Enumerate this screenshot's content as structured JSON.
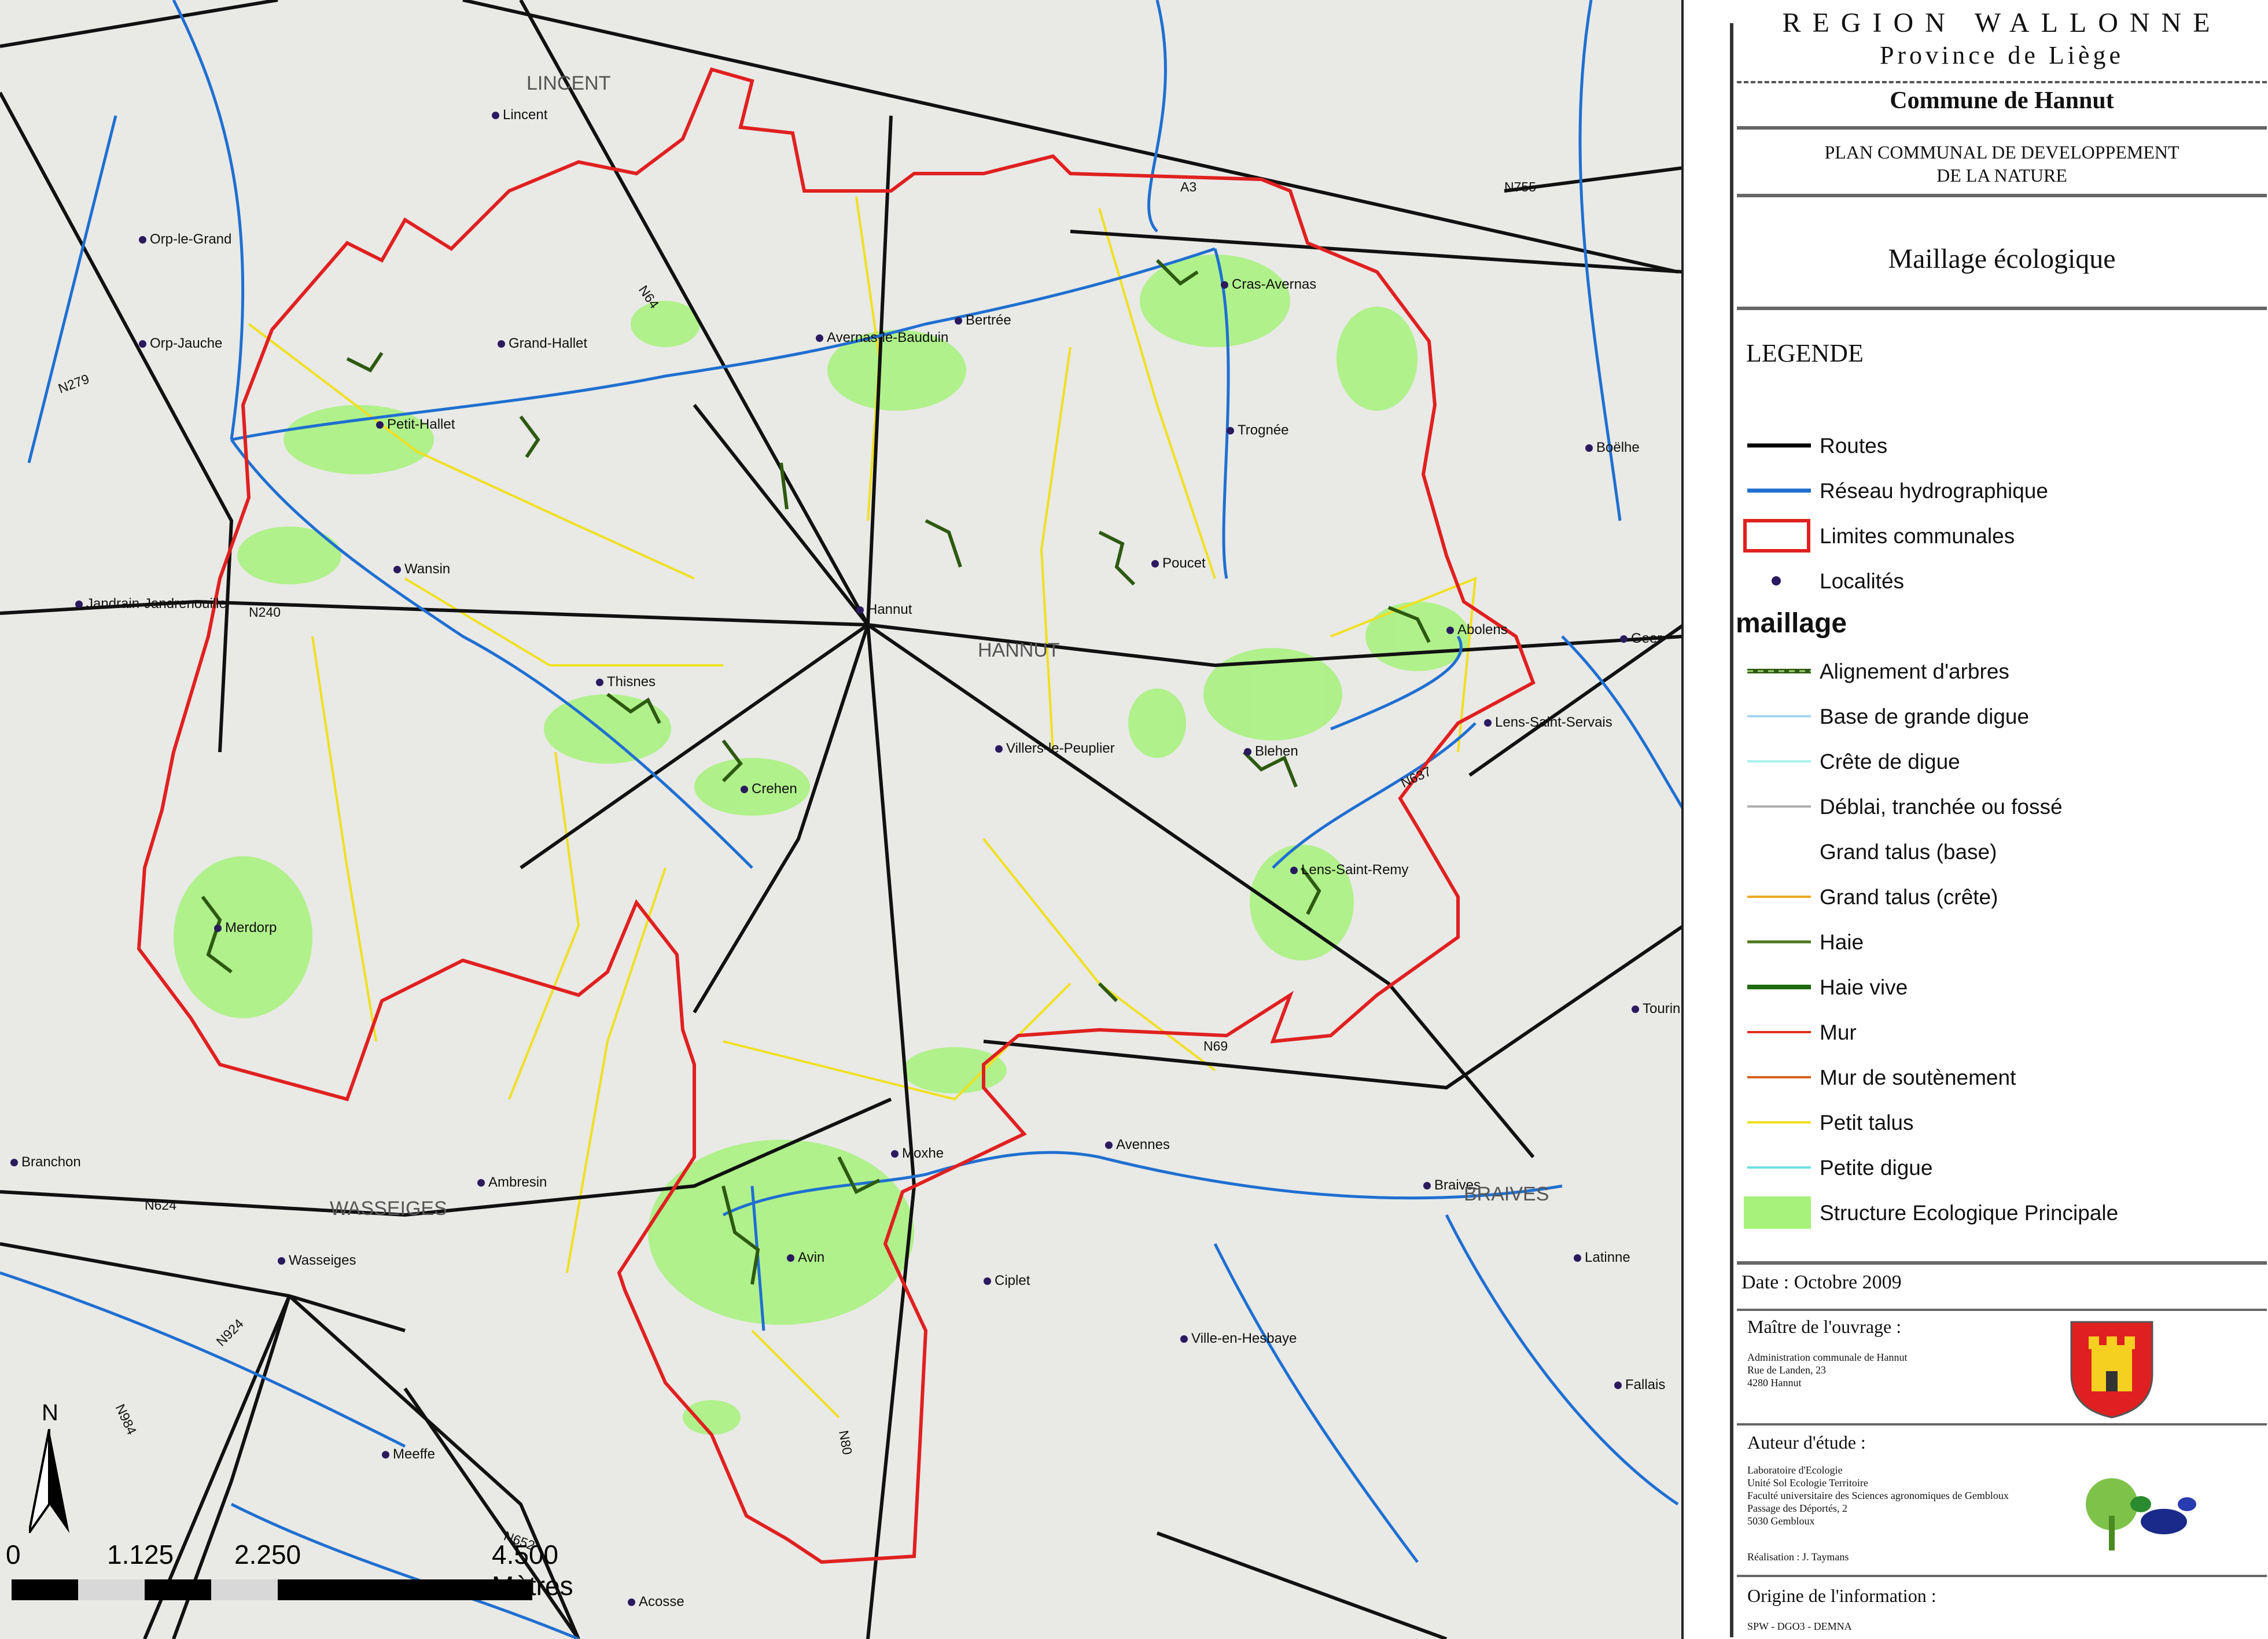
{
  "header": {
    "region": "REGION WALLONNE",
    "province": "Province de Liège",
    "commune": "Commune de Hannut",
    "plan_line1": "PLAN COMMUNAL DE DEVELOPPEMENT",
    "plan_line2": "DE LA NATURE",
    "map_title": "Maillage écologique"
  },
  "legend": {
    "title": "LEGENDE",
    "group_title": "maillage",
    "items_top": [
      {
        "label": "Routes",
        "color": "#000000",
        "kind": "line"
      },
      {
        "label": "Réseau hydrographique",
        "color": "#1f6fd1",
        "kind": "line"
      },
      {
        "label": "Limites communales",
        "color": "#e02020",
        "kind": "box"
      },
      {
        "label": "Localités",
        "color": "#2a1a5e",
        "kind": "dot"
      }
    ],
    "items_maillage": [
      {
        "label": "Alignement d'arbres",
        "color": "#2d5a10",
        "kind": "dashline"
      },
      {
        "label": "Base de grande digue",
        "color": "#a8d4f0",
        "kind": "line"
      },
      {
        "label": "Crête de digue",
        "color": "#a8f0ec",
        "kind": "line"
      },
      {
        "label": "Déblai, tranchée ou fossé",
        "color": "#b0b0b0",
        "kind": "line"
      },
      {
        "label": "Grand talus (base)",
        "color": "#ffffff",
        "kind": "line"
      },
      {
        "label": "Grand talus (crête)",
        "color": "#f0a820",
        "kind": "line"
      },
      {
        "label": "Haie",
        "color": "#4f7a1c",
        "kind": "line"
      },
      {
        "label": "Haie vive",
        "color": "#1e6a10",
        "kind": "line"
      },
      {
        "label": "Mur",
        "color": "#e03020",
        "kind": "line"
      },
      {
        "label": "Mur de soutènement",
        "color": "#d8601a",
        "kind": "line"
      },
      {
        "label": "Petit talus",
        "color": "#f0e020",
        "kind": "line"
      },
      {
        "label": "Petite digue",
        "color": "#6ee0e0",
        "kind": "line"
      },
      {
        "label": "Structure Ecologique Principale",
        "color": "#a6f27a",
        "kind": "fill"
      }
    ]
  },
  "footer": {
    "date": "Date :  Octobre 2009",
    "owner_title": "Maître de l'ouvrage :",
    "owner_lines": [
      "Administration communale de Hannut",
      "Rue de Landen, 23",
      "4280 Hannut"
    ],
    "author_title": "Auteur d'étude :",
    "author_lines": [
      "Laboratoire d'Ecologie",
      "Unité Sol Ecologie Territoire",
      "Faculté universitaire des Sciences agronomiques de Gembloux",
      "Passage des Déportés, 2",
      "5030 Gembloux"
    ],
    "realisation": "Réalisation : J. Taymans",
    "source_title": "Origine de l'information :",
    "source": "SPW - DGO3 - DEMNA"
  },
  "map": {
    "north_label": "N",
    "scale_labels": [
      "0",
      "1.125",
      "2.250",
      "4.500 Mètres"
    ],
    "localities": [
      {
        "name": "Lincent",
        "dot": true
      },
      {
        "name": "Orp-le-Grand",
        "dot": true
      },
      {
        "name": "Orp-Jauche",
        "dot": true
      },
      {
        "name": "Grand-Hallet",
        "dot": true
      },
      {
        "name": "Petit-Hallet",
        "dot": true
      },
      {
        "name": "Wansin",
        "dot": true
      },
      {
        "name": "Jandrain-Jandrenouille",
        "dot": true
      },
      {
        "name": "Thisnes",
        "dot": true
      },
      {
        "name": "Crehen",
        "dot": true
      },
      {
        "name": "Merdorp",
        "dot": true
      },
      {
        "name": "Avernas-le-Bauduin",
        "dot": true
      },
      {
        "name": "Bertrée",
        "dot": true
      },
      {
        "name": "Cras-Avernas",
        "dot": true
      },
      {
        "name": "Trognée",
        "dot": true
      },
      {
        "name": "Poucet",
        "dot": true
      },
      {
        "name": "Hannut",
        "dot": true
      },
      {
        "name": "Villers-le-Peuplier",
        "dot": true
      },
      {
        "name": "Abolens",
        "dot": true
      },
      {
        "name": "Lens-Saint-Servais",
        "dot": true
      },
      {
        "name": "Blehen",
        "dot": true
      },
      {
        "name": "Lens-Saint-Remy",
        "dot": true
      },
      {
        "name": "Boëlhe",
        "dot": true
      },
      {
        "name": "Geer",
        "dot": true
      },
      {
        "name": "Tourinne",
        "dot": true
      },
      {
        "name": "Moxhe",
        "dot": true
      },
      {
        "name": "Avennes",
        "dot": true
      },
      {
        "name": "Braives",
        "dot": true
      },
      {
        "name": "Latinne",
        "dot": true
      },
      {
        "name": "Avin",
        "dot": true
      },
      {
        "name": "Ciplet",
        "dot": true
      },
      {
        "name": "Ville-en-Hesbaye",
        "dot": true
      },
      {
        "name": "Fallais",
        "dot": true
      },
      {
        "name": "Branchon",
        "dot": true
      },
      {
        "name": "Ambresin",
        "dot": true
      },
      {
        "name": "Wasseiges",
        "dot": true
      },
      {
        "name": "Meeffe",
        "dot": true
      },
      {
        "name": "Acosse",
        "dot": true
      }
    ],
    "roads": [
      "N279",
      "N64",
      "A3",
      "N755",
      "N240",
      "N637",
      "N69",
      "N624",
      "N924",
      "N984",
      "N80",
      "N652"
    ],
    "area_labels": [
      "LINCENT",
      "HANNUT",
      "WASSEIGES",
      "BRAIVES"
    ]
  }
}
